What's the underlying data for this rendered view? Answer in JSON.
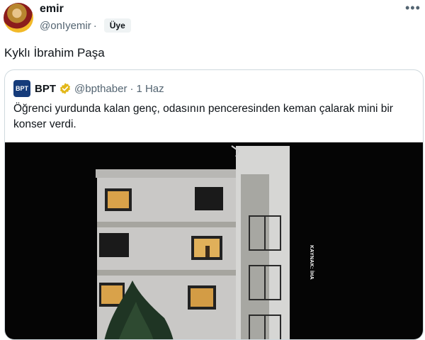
{
  "author": {
    "name": "emir",
    "handle": "@onIyemir",
    "separator": "·",
    "badge": "Üye"
  },
  "tweet": {
    "text": "Kyklı İbrahim Paşa"
  },
  "quote": {
    "avatar_text": "BPT",
    "name": "BPT",
    "handle": "@bpthaber",
    "separator": "·",
    "date": "1 Haz",
    "text": "Öğrenci yurdunda kalan genç, odasının penceresinden keman çalarak mini bir konser verdi.",
    "media_source_label": "KAYNAK: İHA"
  },
  "icons": {
    "more": "more-icon",
    "verified": "verified-badge-icon"
  },
  "colors": {
    "text": "#0f1419",
    "secondary": "#536471",
    "border": "#cfd9de",
    "verified_gold": "#e2b719"
  }
}
